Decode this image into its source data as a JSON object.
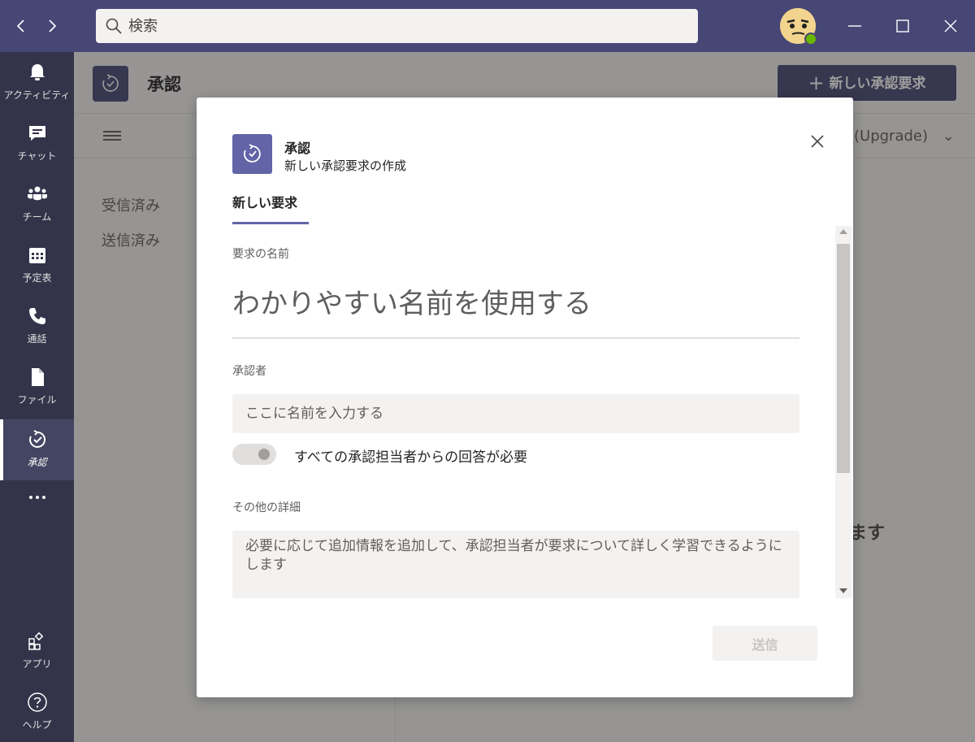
{
  "titlebar": {
    "search_placeholder": "検索",
    "back_icon": "chevron-left-icon",
    "forward_icon": "chevron-right-icon",
    "window_controls": [
      "minimize-icon",
      "maximize-icon",
      "close-icon"
    ]
  },
  "rail": {
    "items": [
      {
        "label": "アクティビティ",
        "icon": "bell-icon"
      },
      {
        "label": "チャット",
        "icon": "chat-icon"
      },
      {
        "label": "チーム",
        "icon": "teams-icon"
      },
      {
        "label": "予定表",
        "icon": "calendar-icon"
      },
      {
        "label": "通話",
        "icon": "phone-icon"
      },
      {
        "label": "ファイル",
        "icon": "file-icon"
      },
      {
        "label": "承認",
        "icon": "approvals-icon"
      },
      {
        "label": "アプリ",
        "icon": "apps-icon"
      },
      {
        "label": "ヘルプ",
        "icon": "help-icon"
      }
    ],
    "more_icon": "more-icon"
  },
  "app": {
    "title": "承認",
    "new_request_label": "新しい承認要求",
    "upgrade_label": "(Upgrade)",
    "side_items": [
      "受信済み",
      "送信済み"
    ],
    "background_text": "ます"
  },
  "dialog": {
    "title": "承認",
    "subtitle": "新しい承認要求の作成",
    "tab": "新しい要求",
    "name_label": "要求の名前",
    "name_placeholder": "わかりやすい名前を使用する",
    "approvers_label": "承認者",
    "approvers_placeholder": "ここに名前を入力する",
    "toggle_label": "すべての承認担当者からの回答が必要",
    "details_label": "その他の詳細",
    "details_placeholder": "必要に応じて追加情報を追加して、承認担当者が要求について詳しく学習できるようにします",
    "send_label": "送信"
  },
  "colors": {
    "titlebar": "#464775",
    "rail": "#33344a",
    "accent": "#6264a7"
  }
}
